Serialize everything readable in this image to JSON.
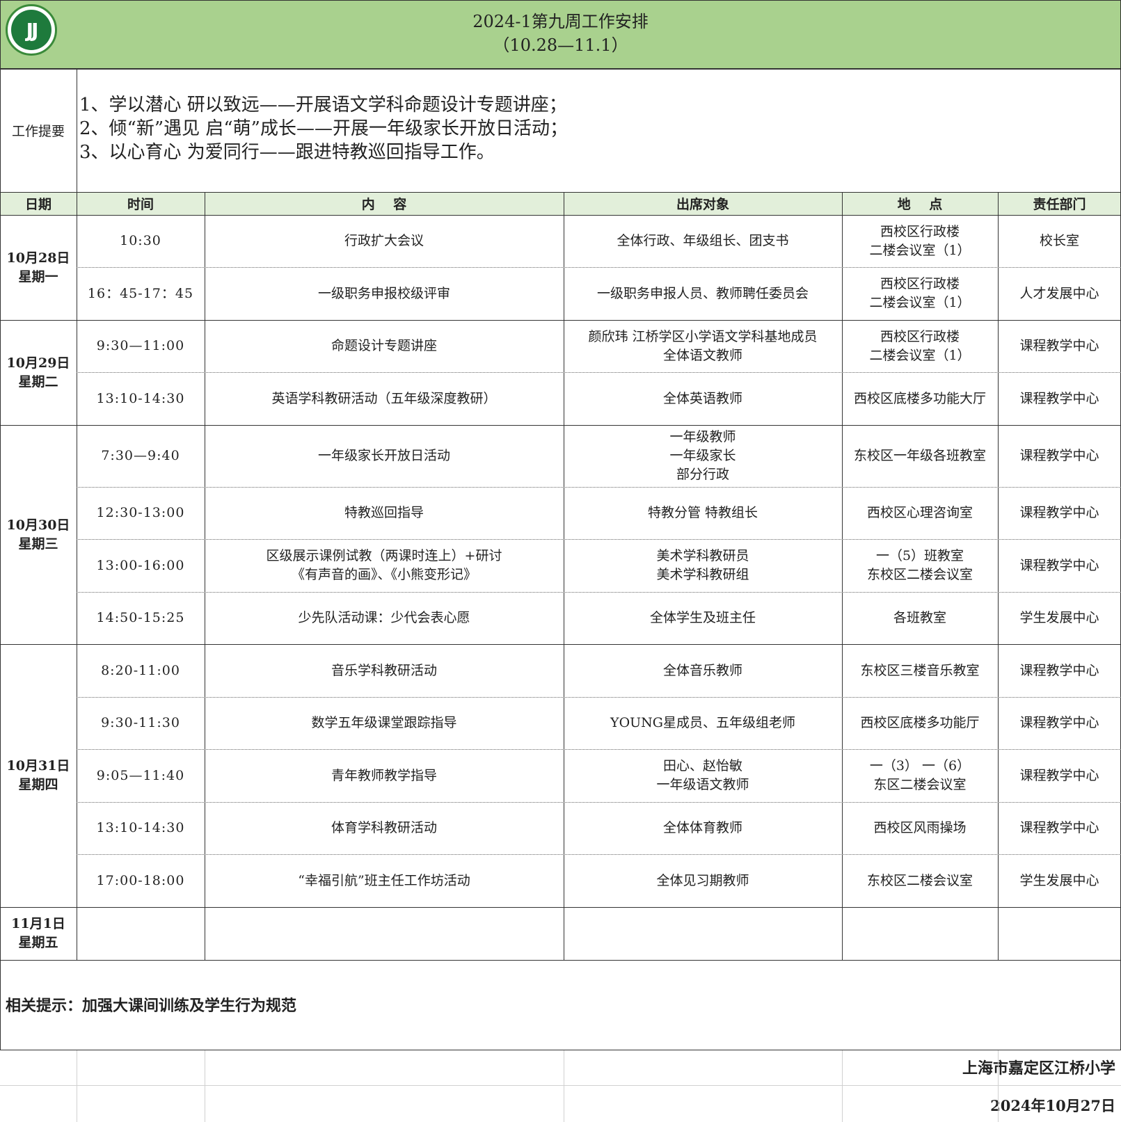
{
  "header": {
    "title": "2024-1第九周工作安排\n（10.28—11.1）"
  },
  "summary": {
    "label": "工作提要",
    "text": "1、学以潜心 研以致远——开展语文学科命题设计专题讲座；\n2、倾“新”遇见 启“萌”成长——开展一年级家长开放日活动；\n3、以心育心 为爱同行——跟进特教巡回指导工作。"
  },
  "columns": {
    "date": "日期",
    "time": "时间",
    "content": "内    容",
    "attendees": "出席对象",
    "location": "地    点",
    "department": "责任部门"
  },
  "days": [
    {
      "date": "10月28日\n星期一"
    },
    {
      "date": "10月29日\n星期二"
    },
    {
      "date": "10月30日\n星期三"
    },
    {
      "date": "10月31日\n星期四"
    },
    {
      "date": "11月1日\n星期五"
    }
  ],
  "rows": [
    {
      "time": "10:30",
      "content": "行政扩大会议",
      "attendees": "全体行政、年级组长、团支书",
      "location": "西校区行政楼\n二楼会议室（1）",
      "department": "校长室"
    },
    {
      "time": "16：45-17：45",
      "content": "一级职务申报校级评审",
      "attendees": "一级职务申报人员、教师聘任委员会",
      "location": "西校区行政楼\n二楼会议室（1）",
      "department": "人才发展中心"
    },
    {
      "time": "9:30—11:00",
      "content": "命题设计专题讲座",
      "attendees": "颜欣玮 江桥学区小学语文学科基地成员\n全体语文教师",
      "location": "西校区行政楼\n二楼会议室（1）",
      "department": "课程教学中心"
    },
    {
      "time": "13:10-14:30",
      "content": "英语学科教研活动（五年级深度教研）",
      "attendees": "全体英语教师",
      "location": "西校区底楼多功能大厅",
      "department": "课程教学中心"
    },
    {
      "time": "7:30—9:40",
      "content": "一年级家长开放日活动",
      "attendees": "一年级教师\n一年级家长\n部分行政",
      "location": "东校区一年级各班教室",
      "department": "课程教学中心"
    },
    {
      "time": "12:30-13:00",
      "content": "特教巡回指导",
      "attendees": "特教分管 特教组长",
      "location": "西校区心理咨询室",
      "department": "课程教学中心"
    },
    {
      "time": "13:00-16:00",
      "content": "区级展示课例试教（两课时连上）+研讨\n《有声音的画》、《小熊变形记》",
      "attendees": "美术学科教研员\n美术学科教研组",
      "location": "一（5）班教室\n东校区二楼会议室",
      "department": "课程教学中心"
    },
    {
      "time": "14:50-15:25",
      "content": "少先队活动课：少代会表心愿",
      "attendees": "全体学生及班主任",
      "location": "各班教室",
      "department": "学生发展中心"
    },
    {
      "time": "8:20-11:00",
      "content": "音乐学科教研活动",
      "attendees": "全体音乐教师",
      "location": "东校区三楼音乐教室",
      "department": "课程教学中心"
    },
    {
      "time": "9:30-11:30",
      "content": "数学五年级课堂跟踪指导",
      "attendees": "YOUNG星成员、五年级组老师",
      "location": "西校区底楼多功能厅",
      "department": "课程教学中心"
    },
    {
      "time": "9:05—11:40",
      "content": "青年教师教学指导",
      "attendees": "田心、赵怡敏\n一年级语文教师",
      "location": "一（3） 一（6）\n东区二楼会议室",
      "department": "课程教学中心"
    },
    {
      "time": "13:10-14:30",
      "content": "体育学科教研活动",
      "attendees": "全体体育教师",
      "location": "西校区风雨操场",
      "department": "课程教学中心"
    },
    {
      "time": "17:00-18:00",
      "content": "“幸福引航”班主任工作坊活动",
      "attendees": "全体见习期教师",
      "location": "东校区二楼会议室",
      "department": "学生发展中心"
    }
  ],
  "footer": {
    "hint": "相关提示：加强大课间训练及学生行为规范",
    "school": "上海市嘉定区江桥小学",
    "date": "2024年10月27日"
  }
}
